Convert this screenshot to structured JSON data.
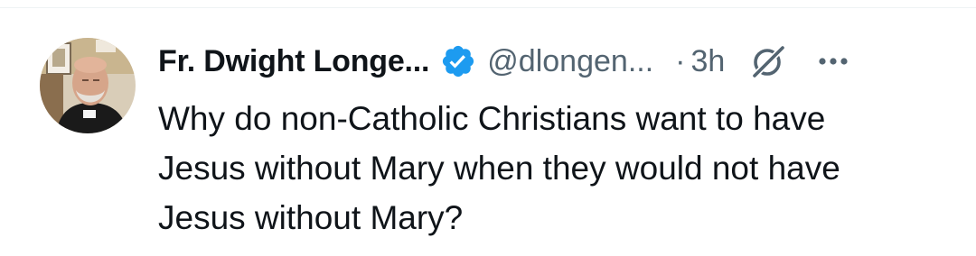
{
  "post": {
    "author": {
      "display_name": "Fr. Dwight Longe...",
      "handle": "@dlongen...",
      "verified_icon": "verified-badge-icon",
      "avatar": "profile-photo"
    },
    "separator": "·",
    "timestamp": "3h",
    "grok_icon": "grok-icon",
    "more_icon": "more-options-icon",
    "text": "Why do non-Catholic Christians want to have\nJesus without Mary when they would not have\nJesus without Mary?"
  },
  "colors": {
    "primary_text": "#0f1419",
    "secondary_text": "#536471",
    "verified_blue": "#1d9bf0",
    "divider": "#eff3f4"
  }
}
